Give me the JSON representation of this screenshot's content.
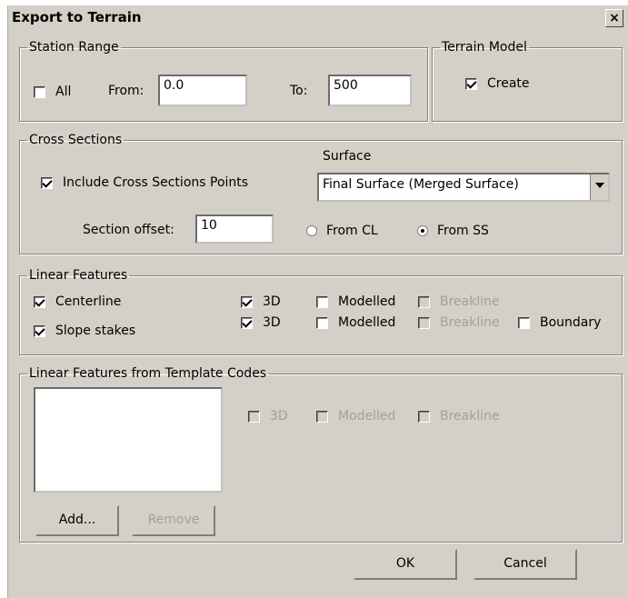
{
  "window": {
    "title": "Export to Terrain",
    "close_symbol": "×"
  },
  "station_range": {
    "legend": "Station Range",
    "all_label": "All",
    "all_checked": false,
    "from_label": "From:",
    "from_value": "0.0",
    "to_label": "To:",
    "to_value": "500"
  },
  "terrain_model": {
    "legend": "Terrain Model",
    "create_label": "Create",
    "create_checked": true
  },
  "cross_sections": {
    "legend": "Cross Sections",
    "include_label": "Include Cross Sections Points",
    "include_checked": true,
    "surface_label": "Surface",
    "surface_value": "Final Surface (Merged Surface)",
    "offset_label": "Section offset:",
    "offset_value": "10",
    "from_cl_label": "From CL",
    "from_ss_label": "From SS",
    "selected_radio": "From SS"
  },
  "linear_features": {
    "legend": "Linear Features",
    "rows": [
      {
        "label": "Centerline",
        "checked": true,
        "three_d": true,
        "modelled": false,
        "breakline": false
      },
      {
        "label": "Slope stakes",
        "checked": true,
        "three_d": true,
        "modelled": false,
        "breakline": false
      }
    ],
    "three_d_label": "3D",
    "modelled_label": "Modelled",
    "breakline_label": "Breakline",
    "boundary_label": "Boundary",
    "boundary_checked": false
  },
  "template_codes": {
    "legend": "Linear Features from Template Codes",
    "three_d_label": "3D",
    "modelled_label": "Modelled",
    "breakline_label": "Breakline",
    "add_label": "Add...",
    "remove_label": "Remove"
  },
  "buttons": {
    "ok": "OK",
    "cancel": "Cancel"
  }
}
